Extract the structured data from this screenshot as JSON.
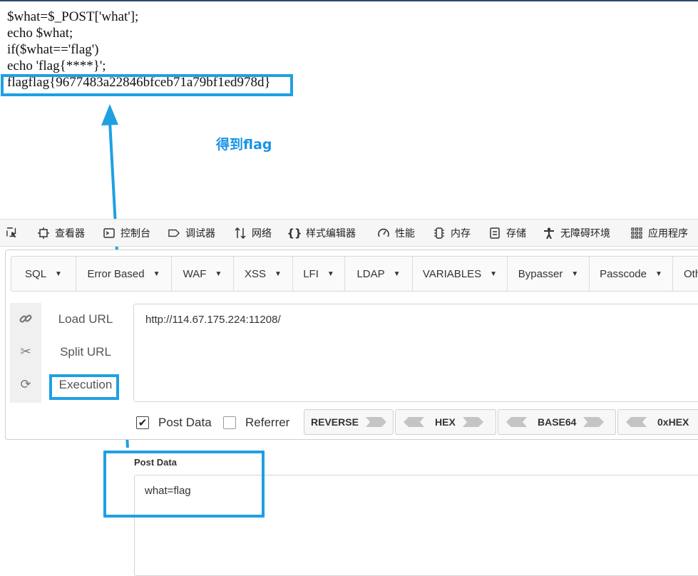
{
  "source_code": {
    "lines": [
      "$what=$_POST['what'];",
      "echo $what;",
      "if($what=='flag')",
      "echo 'flag{****}';",
      "flagflag{9677483a22846bfceb71a79bf1ed978d}"
    ]
  },
  "annotation": {
    "note": "得到flag",
    "highlight_color": "#1fa0e3"
  },
  "devtools": {
    "tabs": [
      {
        "label": "查看器",
        "icon": "inspector-icon"
      },
      {
        "label": "控制台",
        "icon": "console-icon"
      },
      {
        "label": "调试器",
        "icon": "debugger-icon"
      },
      {
        "label": "网络",
        "icon": "network-icon"
      },
      {
        "label": "样式编辑器",
        "icon": "style-editor-icon"
      },
      {
        "label": "性能",
        "icon": "performance-icon"
      },
      {
        "label": "内存",
        "icon": "memory-icon"
      },
      {
        "label": "存储",
        "icon": "storage-icon"
      },
      {
        "label": "无障碍环境",
        "icon": "accessibility-icon"
      },
      {
        "label": "应用程序",
        "icon": "application-icon"
      }
    ]
  },
  "hackbar": {
    "menus": [
      "SQL",
      "Error Based",
      "WAF",
      "XSS",
      "LFI",
      "LDAP",
      "VARIABLES",
      "Bypasser",
      "Passcode",
      "Other"
    ],
    "actions": {
      "load_url": "Load URL",
      "split_url": "Split URL",
      "execution": "Execution"
    },
    "url": "http://114.67.175.224:11208/",
    "options": {
      "post_data": "Post Data",
      "post_data_checked": true,
      "referrer": "Referrer",
      "referrer_checked": false
    },
    "encoders": [
      "REVERSE",
      "HEX",
      "BASE64",
      "0xHEX"
    ],
    "post_data_label": "Post Data",
    "post_data_value": "what=flag"
  }
}
